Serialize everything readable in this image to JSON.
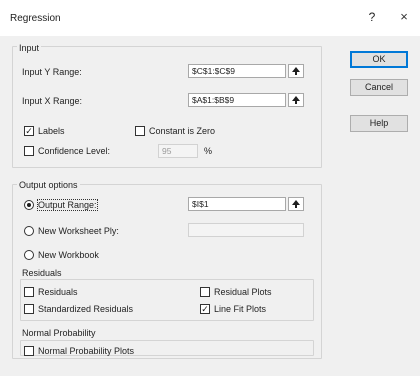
{
  "title": "Regression",
  "titlebar": {
    "help": "?",
    "close": "×"
  },
  "input": {
    "group_label": "Input",
    "y_range_label": "Input Y Range:",
    "y_range_value": "$C$1:$C$9",
    "x_range_label": "Input X Range:",
    "x_range_value": "$A$1:$B$9",
    "labels_label": "Labels",
    "labels_checked": true,
    "constant_zero_label": "Constant is Zero",
    "constant_zero_checked": false,
    "confidence_label": "Confidence Level:",
    "confidence_checked": false,
    "confidence_value": "95",
    "confidence_unit": "%"
  },
  "output": {
    "group_label": "Output options",
    "output_range_label": "Output Range:",
    "output_range_value": "$I$1",
    "output_range_selected": true,
    "new_ply_label": "New Worksheet Ply:",
    "new_ply_value": "",
    "new_workbook_label": "New Workbook"
  },
  "residuals": {
    "group_label": "Residuals",
    "residuals_label": "Residuals",
    "residuals_checked": false,
    "standardized_label": "Standardized Residuals",
    "standardized_checked": false,
    "residual_plots_label": "Residual Plots",
    "residual_plots_checked": false,
    "line_fit_label": "Line Fit Plots",
    "line_fit_checked": true
  },
  "normal_probability": {
    "group_label": "Normal Probability",
    "plots_label": "Normal Probability Plots",
    "plots_checked": false
  },
  "buttons": {
    "ok": "OK",
    "cancel": "Cancel",
    "help": "Help"
  },
  "icons": {
    "ref_button": "range-selector-icon",
    "checkmark": "✓"
  },
  "colors": {
    "accent": "#0078d7",
    "dialog_bg": "#f0f0f0"
  }
}
